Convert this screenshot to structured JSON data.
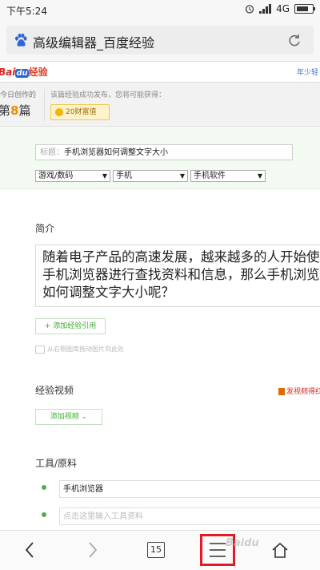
{
  "status": {
    "time": "下午5:24",
    "network": "4G"
  },
  "browser": {
    "tab_title": "高级编辑器_百度经验",
    "tab_count": "15"
  },
  "header": {
    "logo_bai": "Bai",
    "logo_du": "du",
    "logo_jingyan": "经验",
    "user_link": "年少轻"
  },
  "stats": {
    "today_created": "今日创作的",
    "article_count_prefix": "第",
    "article_count": "8",
    "article_count_suffix": "篇",
    "publish_notice": "该篇经验成功发布，您将可能获得：",
    "wealth_reward": "20财富值"
  },
  "form": {
    "title_label": "标题：",
    "title_value": "手机浏览器如何调整文字大小",
    "category1": "游戏/数码",
    "category2": "手机",
    "category3": "手机软件",
    "intro_label": "简介",
    "intro_lines": [
      "随着电子产品的高速发展，越来越多的人开始使",
      "手机浏览器进行查找资料和信息，那么手机浏览",
      "如何调整文字大小呢？"
    ],
    "add_reference": "+ 添加经验引用",
    "drag_image_hint": "从右侧图库拖动图片到此处",
    "video_label": "经验视频",
    "send_video": "发视频得红",
    "add_video": "添加视频",
    "tools_label": "工具/原料",
    "tool1": "手机浏览器",
    "tool2_placeholder": "点击这里输入工具资料"
  },
  "watermark": "Baidu"
}
